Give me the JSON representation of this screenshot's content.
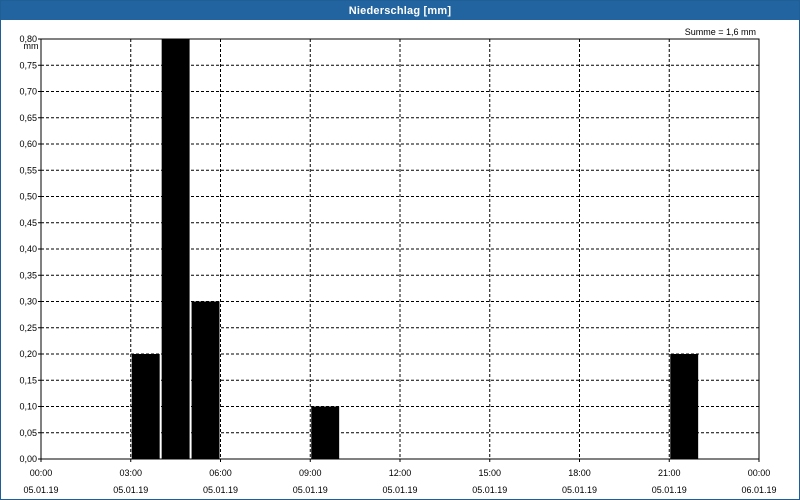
{
  "window": {
    "title": "Niederschlag [mm]"
  },
  "chart_data": {
    "type": "bar",
    "title": "Niederschlag [mm]",
    "annotation": "Summe = 1,6 mm",
    "ylabel": "mm",
    "xlabel": "",
    "ylim": [
      0,
      0.8
    ],
    "y_ticks": [
      "0,00",
      "0,05",
      "0,10",
      "0,15",
      "0,20",
      "0,25",
      "0,30",
      "0,35",
      "0,40",
      "0,45",
      "0,50",
      "0,55",
      "0,60",
      "0,65",
      "0,70",
      "0,75",
      "0,80"
    ],
    "xlim": [
      "05.01.19 00:00",
      "06.01.19 00:00"
    ],
    "x_ticks": [
      {
        "time": "00:00",
        "date": "05.01.19"
      },
      {
        "time": "03:00",
        "date": "05.01.19"
      },
      {
        "time": "06:00",
        "date": "05.01.19"
      },
      {
        "time": "09:00",
        "date": "05.01.19"
      },
      {
        "time": "12:00",
        "date": "05.01.19"
      },
      {
        "time": "15:00",
        "date": "05.01.19"
      },
      {
        "time": "18:00",
        "date": "05.01.19"
      },
      {
        "time": "21:00",
        "date": "05.01.19"
      },
      {
        "time": "00:00",
        "date": "06.01.19"
      }
    ],
    "series": [
      {
        "values": [
          {
            "x": "05.01.19 03:00",
            "y": 0.2
          },
          {
            "x": "05.01.19 04:00",
            "y": 0.8
          },
          {
            "x": "05.01.19 05:00",
            "y": 0.3
          },
          {
            "x": "05.01.19 09:00",
            "y": 0.1
          },
          {
            "x": "05.01.19 21:00",
            "y": 0.2
          }
        ]
      }
    ],
    "bar_color": "#000000",
    "grid": true,
    "grid_style": "dashed"
  }
}
